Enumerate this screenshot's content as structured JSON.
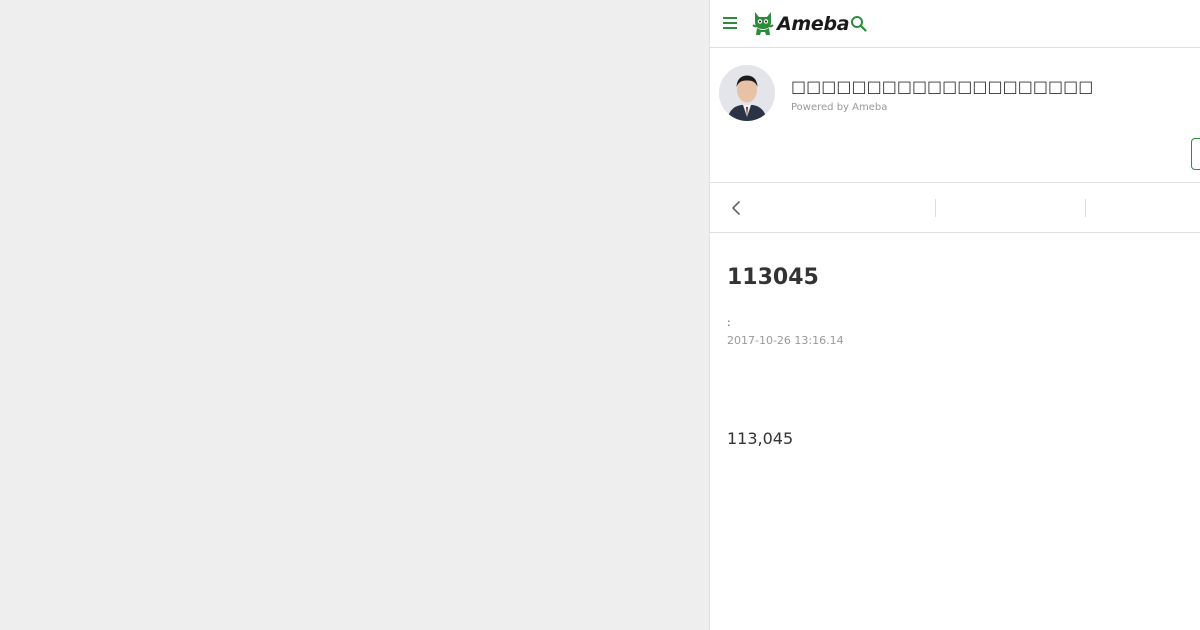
{
  "header": {
    "logo_text": "Ameba",
    "brand_color": "#2d8c3c",
    "icons": [
      "menu-icon",
      "ameba-logo-icon",
      "search-icon"
    ]
  },
  "blog": {
    "title": "□□□□□□□□□□□□□□□□□□□□",
    "powered_by": "Powered by Ameba"
  },
  "article": {
    "title": "113045",
    "theme_separator": ":",
    "timestamp": "2017-10-26 13:16.14",
    "body": "113,045"
  }
}
